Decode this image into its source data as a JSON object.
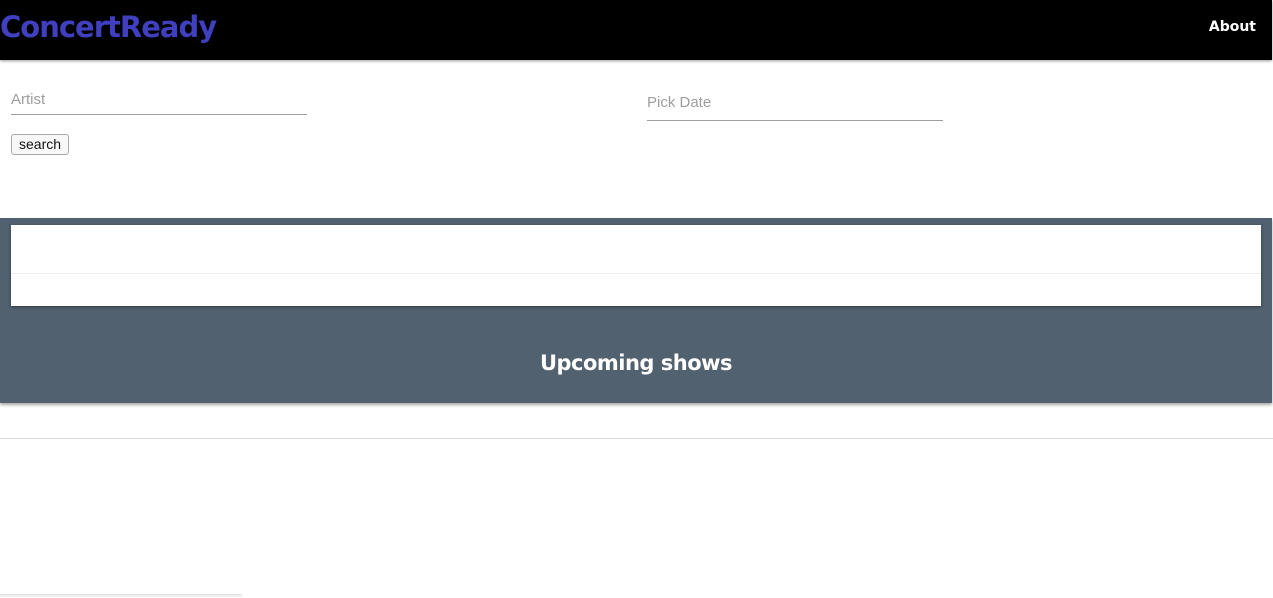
{
  "header": {
    "brand": "ConcertReady",
    "nav_about": "About"
  },
  "search": {
    "artist_placeholder": "Artist",
    "date_placeholder": "Pick Date",
    "button_label": "search"
  },
  "upcoming": {
    "title": "Upcoming shows"
  },
  "colors": {
    "navbar": "#000000",
    "brand": "#3f3fbf",
    "section": "#52616f"
  }
}
